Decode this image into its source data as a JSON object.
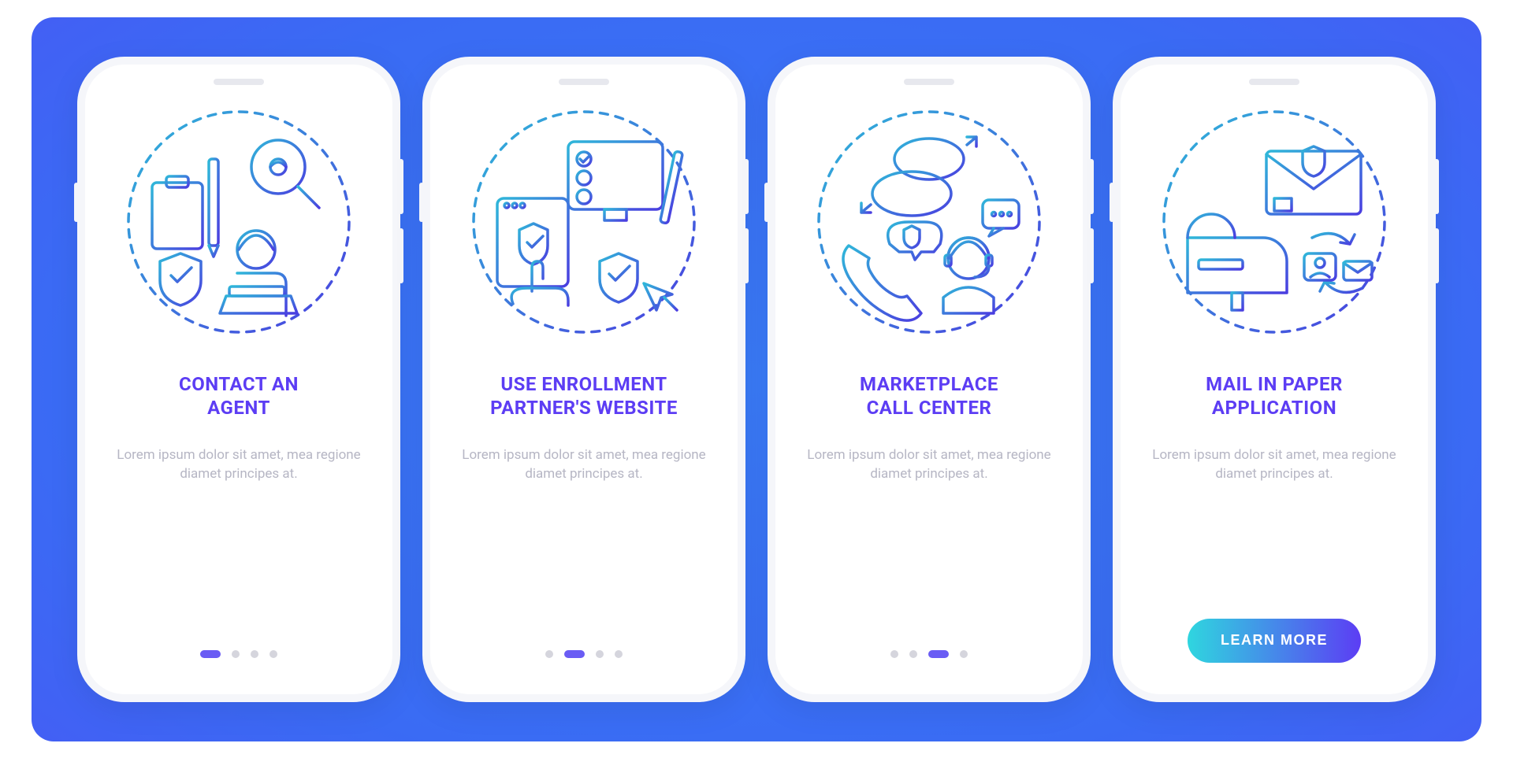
{
  "cta_label": "LEARN MORE",
  "description": "Lorem ipsum dolor sit amet, mea regione diamet principes at.",
  "screens": [
    {
      "title": "CONTACT AN\nAGENT",
      "icon_name": "agent-icon",
      "indicator": {
        "total": 4,
        "active_index": 0
      },
      "has_cta": false
    },
    {
      "title": "USE ENROLLMENT\nPARTNER'S WEBSITE",
      "icon_name": "enrollment-website-icon",
      "indicator": {
        "total": 4,
        "active_index": 1
      },
      "has_cta": false
    },
    {
      "title": "MARKETPLACE\nCALL CENTER",
      "icon_name": "call-center-icon",
      "indicator": {
        "total": 4,
        "active_index": 2
      },
      "has_cta": false
    },
    {
      "title": "MAIL IN PAPER\nAPPLICATION",
      "icon_name": "mail-application-icon",
      "indicator": null,
      "has_cta": true
    }
  ]
}
